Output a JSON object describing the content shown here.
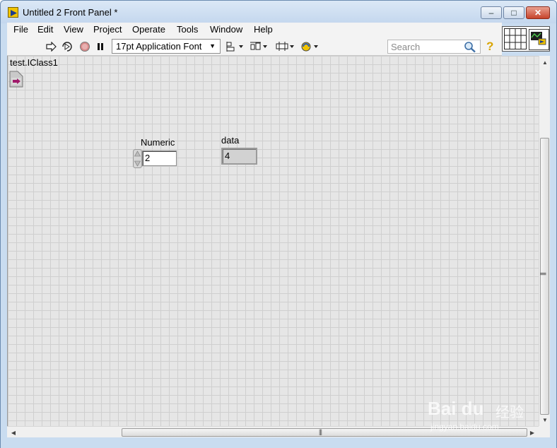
{
  "window": {
    "title": "Untitled 2 Front Panel *",
    "minimize_glyph": "–",
    "maximize_glyph": "□",
    "close_glyph": "✕"
  },
  "menu": {
    "items": [
      {
        "label": "File"
      },
      {
        "label": "Edit"
      },
      {
        "label": "View"
      },
      {
        "label": "Project"
      },
      {
        "label": "Operate"
      },
      {
        "label": "Tools"
      },
      {
        "label": "Window"
      },
      {
        "label": "Help"
      }
    ]
  },
  "toolbar": {
    "font_label": "17pt Application Font",
    "search_placeholder": "Search",
    "help_glyph": "?"
  },
  "panel": {
    "class_label": "test.IClass1",
    "numeric": {
      "label": "Numeric",
      "value": "2"
    },
    "indicator": {
      "label": "data",
      "value": "4"
    }
  },
  "scrollbar": {
    "grip": "|||"
  },
  "watermark": {
    "main": "Bai du",
    "cn": "经验",
    "sub": "jingyan.baidu.com"
  },
  "colors": {
    "title_bar": "#c9dcf0",
    "canvas": "#e6e6e6",
    "close_button": "#c7432b"
  }
}
